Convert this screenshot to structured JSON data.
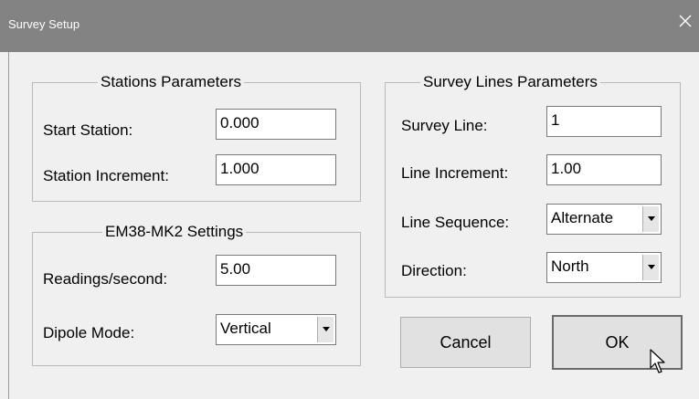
{
  "window": {
    "title": "Survey Setup"
  },
  "stations": {
    "title": "Stations Parameters",
    "start_label": "Start Station:",
    "start_value": "0.000",
    "increment_label": "Station Increment:",
    "increment_value": "1.000"
  },
  "em38": {
    "title": "EM38-MK2 Settings",
    "readings_label": "Readings/second:",
    "readings_value": "5.00",
    "dipole_label": "Dipole Mode:",
    "dipole_value": "Vertical"
  },
  "survey_lines": {
    "title": "Survey Lines Parameters",
    "line_label": "Survey Line:",
    "line_value": "1",
    "increment_label": "Line Increment:",
    "increment_value": "1.00",
    "sequence_label": "Line Sequence:",
    "sequence_value": "Alternate",
    "direction_label": "Direction:",
    "direction_value": "North"
  },
  "buttons": {
    "cancel": "Cancel",
    "ok": "OK"
  },
  "icons": {
    "close": "close-icon",
    "dropdown": "chevron-down-icon",
    "cursor": "mouse-pointer-icon"
  }
}
